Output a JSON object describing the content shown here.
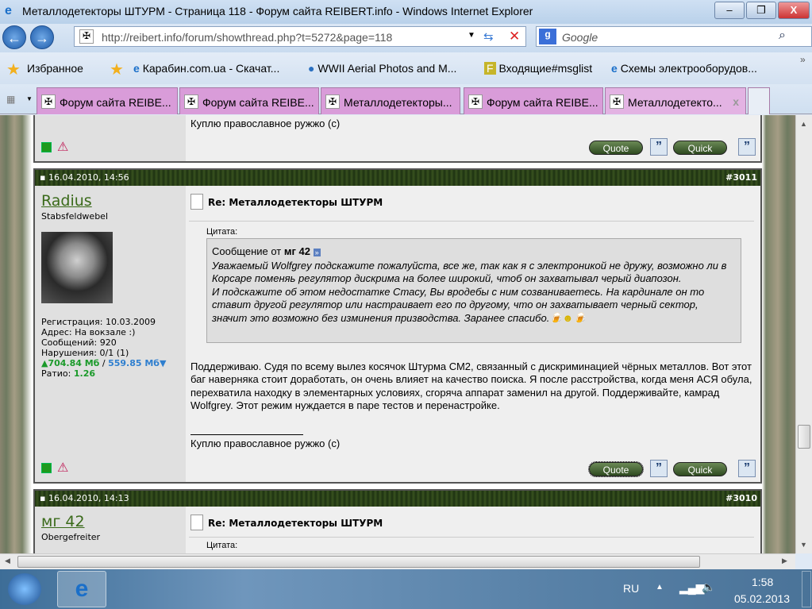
{
  "window": {
    "title": "Металлодетекторы ШТУРМ - Страница 118 - Форум сайта REIBERT.info - Windows Internet Explorer",
    "minimize": "–",
    "restore": "❐",
    "close": "X"
  },
  "nav": {
    "back": "←",
    "forward": "→",
    "url": "http://reibert.info/forum/showthread.php?t=5272&page=118",
    "search_placeholder": "Google",
    "refresh": "⇆",
    "stop": "✕",
    "search_btn": "⌕"
  },
  "favorites": {
    "label": "Избранное",
    "items": [
      "Карабин.com.ua - Скачат...",
      "WWII Aerial Photos and M...",
      "Входящие#msglist",
      "Схемы электрооборудов..."
    ],
    "more": "»"
  },
  "tabs": [
    "Форум сайта REIBE...",
    "Форум сайта REIBE...",
    "Металлодетекторы...",
    "Форум сайта REIBE...",
    "Металлодетекто..."
  ],
  "tab_close": "x",
  "posts": [
    {
      "signature": "Куплю православное ружжо (с)",
      "quote_btn": "Quote",
      "quick_btn": "Quick"
    },
    {
      "date": "16.04.2010, 14:56",
      "number": "#3011",
      "user": "Radius",
      "rank": "Stabsfeldwebel",
      "stats": {
        "reg": "Регистрация: 10.03.2009",
        "addr": "Адрес: На вокзале :)",
        "posts": "Сообщений: 920",
        "warn": "Нарушения: 0/1 (1)",
        "up": "▲704.84 Мб",
        "sep": " / ",
        "down": "559.85 Мб▼",
        "ratio_label": "Ратио: ",
        "ratio": "1.26"
      },
      "title": "Re: Металлодетекторы ШТУРМ",
      "quote_label": "Цитата:",
      "quote_from": "Сообщение от ",
      "quote_author": "мг 42",
      "quote_text": "Уважаемый Wolfgrey подскажите пожалуйста, все же, так как я с электроникой не дружу, возможно ли в Корсаре поменяь регулятор дискрима на более широкий, чтоб он захватывал черый диапозон.",
      "quote_text2": "И подскажите об этом недостатке Стасу, Вы вродебы с ним созваниваетесь. На кардинале он то ставит другой регулятор или настраивает его по другому, что он захватывает черный сектор, значит это возможно без изминения призводства. Заранее спасибо.",
      "body": "Поддерживаю. Судя по всему вылез косячок Штурма СМ2, связанный с дискриминацией чёрных металлов. Вот этот баг наверняка стоит доработать, он очень влияет на качество поиска. Я после расстройства, когда меня АСЯ обула, перехватила находку в элементарных условиях, сгоряча аппарат заменил на другой. Поддерживайте, камрад Wolfgrey. Этот режим нуждается в паре тестов и перенастройке.",
      "signature": "Куплю православное ружжо (с)",
      "quote_btn": "Quote",
      "quick_btn": "Quick"
    },
    {
      "date": "16.04.2010, 14:13",
      "number": "#3010",
      "user": "мг 42",
      "rank": "Obergefreiter",
      "title": "Re: Металлодетекторы ШТУРМ",
      "quote_label": "Цитата:"
    }
  ],
  "taskbar": {
    "lang": "RU",
    "time": "1:58",
    "date": "05.02.2013"
  }
}
